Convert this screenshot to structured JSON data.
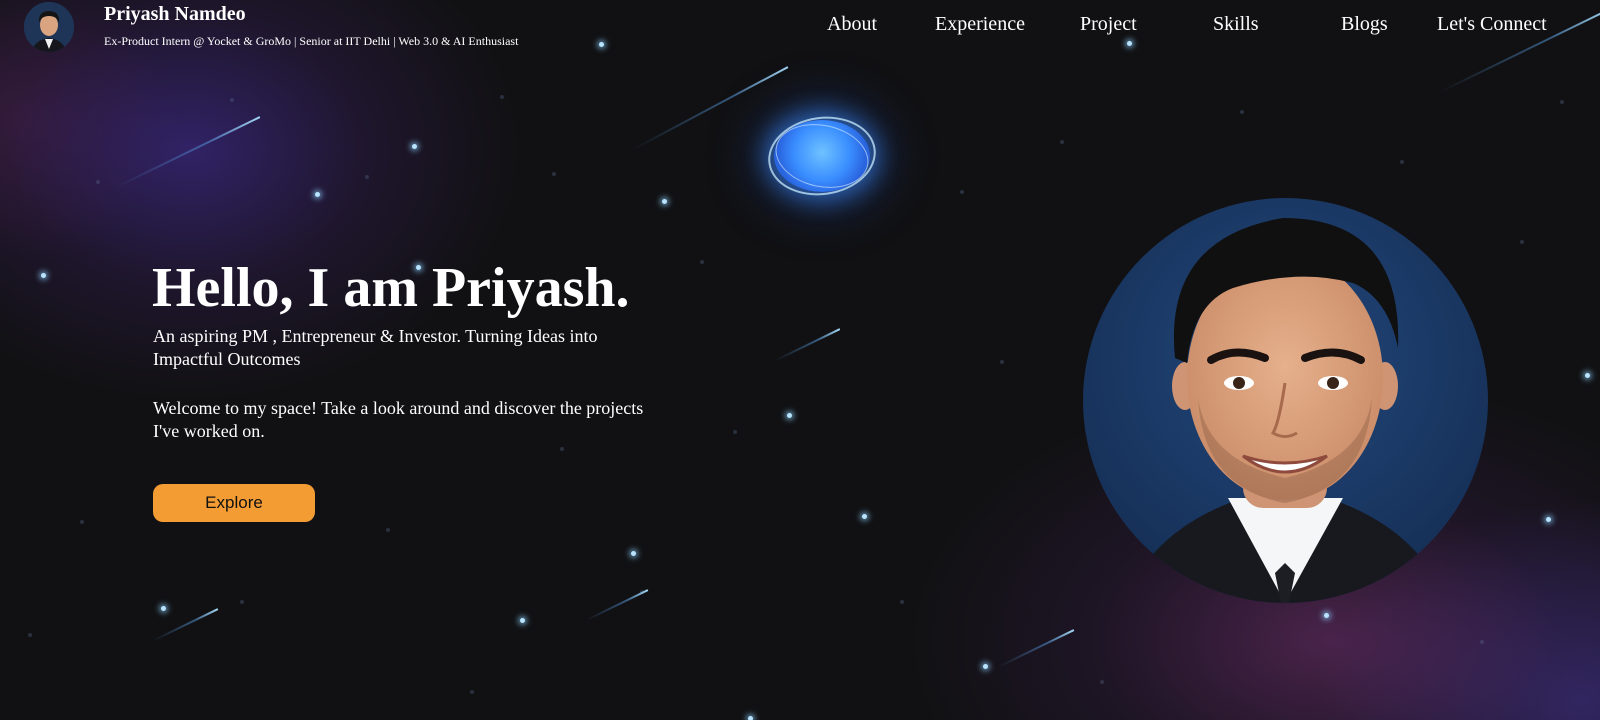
{
  "header": {
    "name": "Priyash Namdeo",
    "tagline": "Ex-Product Intern @ Yocket & GroMo | Senior at IIT Delhi | Web 3.0 & AI Enthusiast",
    "avatar_icon": "profile-photo"
  },
  "nav": {
    "items": [
      {
        "label": "About"
      },
      {
        "label": "Experience"
      },
      {
        "label": "Project"
      },
      {
        "label": "Skills"
      },
      {
        "label": "Blogs"
      },
      {
        "label": "Let's Connect"
      }
    ]
  },
  "hero": {
    "title": "Hello, I am Priyash.",
    "subtitle": "An aspiring PM , Entrepreneur & Investor. Turning Ideas into Impactful Outcomes",
    "welcome": "Welcome to my space! Take a look around and discover the projects I've worked on.",
    "cta_label": "Explore",
    "portrait_icon": "profile-photo"
  },
  "colors": {
    "background": "#111113",
    "accent": "#f39c34",
    "text": "#ffffff",
    "star": "#b8e4ff",
    "orb": "#3a8eff"
  }
}
